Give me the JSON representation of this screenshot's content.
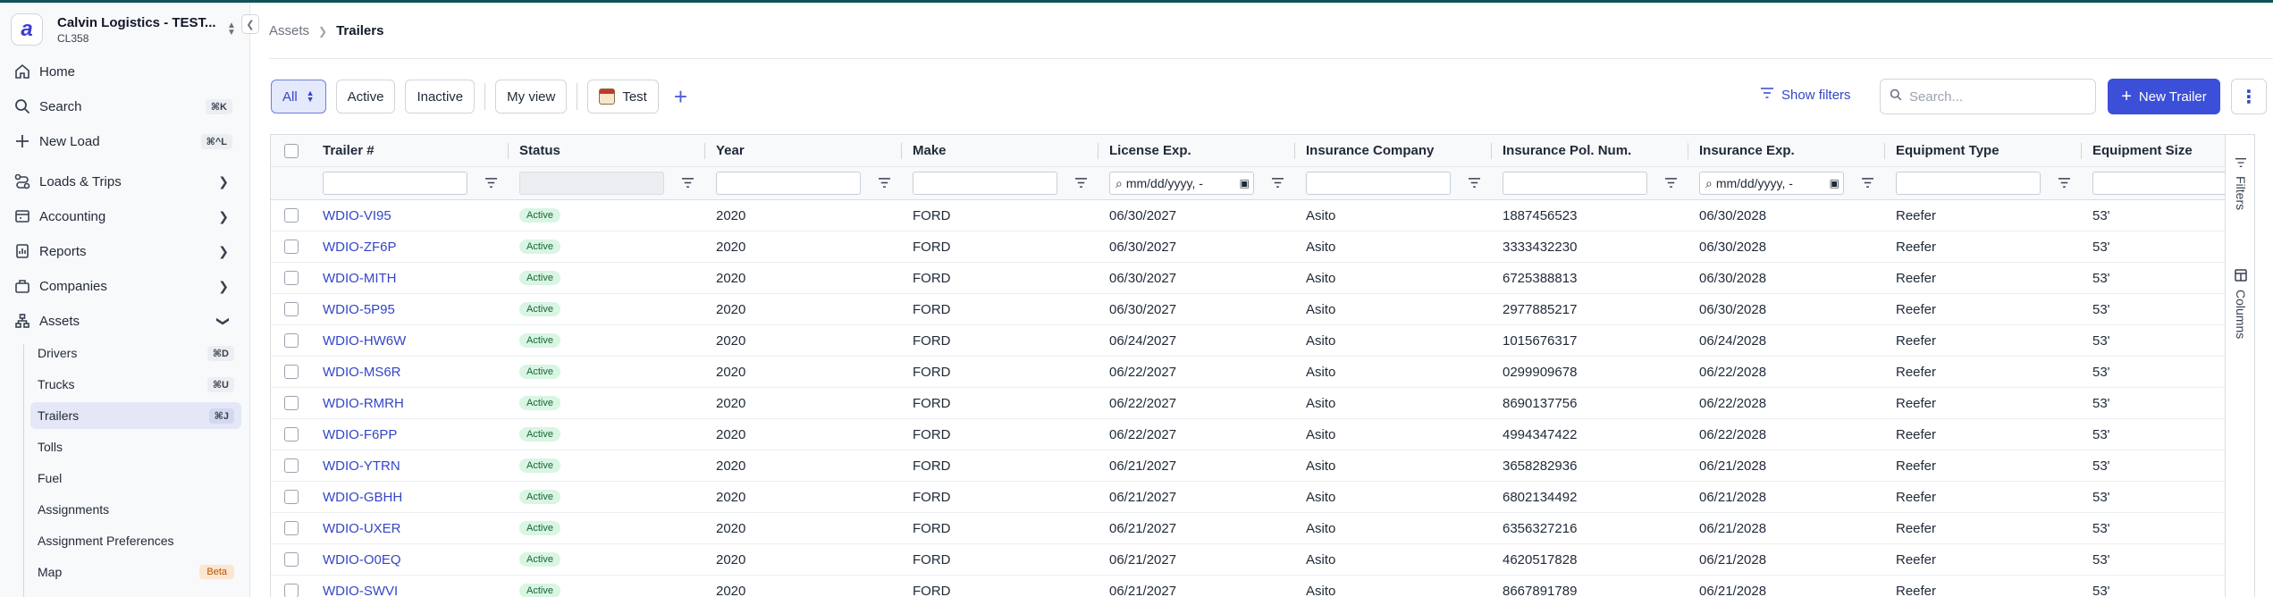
{
  "org": {
    "name": "Calvin Logistics - TEST...",
    "code": "CL358",
    "logo_letter": "a"
  },
  "sidebar": {
    "top_items": [
      {
        "label": "Home",
        "icon": "home-icon"
      },
      {
        "label": "Search",
        "icon": "search-icon",
        "shortcut": "⌘K"
      },
      {
        "label": "New Load",
        "icon": "plus-icon",
        "shortcut": "⌘^L"
      }
    ],
    "sections": [
      {
        "label": "Loads & Trips",
        "icon": "route-icon"
      },
      {
        "label": "Accounting",
        "icon": "accounting-icon"
      },
      {
        "label": "Reports",
        "icon": "reports-icon"
      },
      {
        "label": "Companies",
        "icon": "companies-icon"
      },
      {
        "label": "Assets",
        "icon": "assets-icon",
        "expanded": true
      }
    ],
    "asset_items": [
      {
        "label": "Drivers",
        "shortcut": "⌘D"
      },
      {
        "label": "Trucks",
        "shortcut": "⌘U"
      },
      {
        "label": "Trailers",
        "shortcut": "⌘J",
        "active": true
      },
      {
        "label": "Tolls"
      },
      {
        "label": "Fuel"
      },
      {
        "label": "Assignments"
      },
      {
        "label": "Assignment Preferences"
      },
      {
        "label": "Map",
        "badge": "Beta"
      }
    ]
  },
  "breadcrumb": {
    "parent": "Assets",
    "current": "Trailers"
  },
  "toolbar": {
    "views": [
      "All",
      "Active",
      "Inactive"
    ],
    "my_view": "My view",
    "saved_view": "Test",
    "show_filters": "Show filters",
    "search_placeholder": "Search...",
    "new_button": "New Trailer"
  },
  "table": {
    "columns": [
      "Trailer #",
      "Status",
      "Year",
      "Make",
      "License Exp.",
      "Insurance Company",
      "Insurance Pol. Num.",
      "Insurance Exp.",
      "Equipment Type",
      "Equipment Size"
    ],
    "date_placeholder": "mm/dd/yyyy, -",
    "rows": [
      [
        "WDIO-VI95",
        "Active",
        "2020",
        "FORD",
        "06/30/2027",
        "Asito",
        "1887456523",
        "06/30/2028",
        "Reefer",
        "53'"
      ],
      [
        "WDIO-ZF6P",
        "Active",
        "2020",
        "FORD",
        "06/30/2027",
        "Asito",
        "3333432230",
        "06/30/2028",
        "Reefer",
        "53'"
      ],
      [
        "WDIO-MITH",
        "Active",
        "2020",
        "FORD",
        "06/30/2027",
        "Asito",
        "6725388813",
        "06/30/2028",
        "Reefer",
        "53'"
      ],
      [
        "WDIO-5P95",
        "Active",
        "2020",
        "FORD",
        "06/30/2027",
        "Asito",
        "2977885217",
        "06/30/2028",
        "Reefer",
        "53'"
      ],
      [
        "WDIO-HW6W",
        "Active",
        "2020",
        "FORD",
        "06/24/2027",
        "Asito",
        "1015676317",
        "06/24/2028",
        "Reefer",
        "53'"
      ],
      [
        "WDIO-MS6R",
        "Active",
        "2020",
        "FORD",
        "06/22/2027",
        "Asito",
        "0299909678",
        "06/22/2028",
        "Reefer",
        "53'"
      ],
      [
        "WDIO-RMRH",
        "Active",
        "2020",
        "FORD",
        "06/22/2027",
        "Asito",
        "8690137756",
        "06/22/2028",
        "Reefer",
        "53'"
      ],
      [
        "WDIO-F6PP",
        "Active",
        "2020",
        "FORD",
        "06/22/2027",
        "Asito",
        "4994347422",
        "06/22/2028",
        "Reefer",
        "53'"
      ],
      [
        "WDIO-YTRN",
        "Active",
        "2020",
        "FORD",
        "06/21/2027",
        "Asito",
        "3658282936",
        "06/21/2028",
        "Reefer",
        "53'"
      ],
      [
        "WDIO-GBHH",
        "Active",
        "2020",
        "FORD",
        "06/21/2027",
        "Asito",
        "6802134492",
        "06/21/2028",
        "Reefer",
        "53'"
      ],
      [
        "WDIO-UXER",
        "Active",
        "2020",
        "FORD",
        "06/21/2027",
        "Asito",
        "6356327216",
        "06/21/2028",
        "Reefer",
        "53'"
      ],
      [
        "WDIO-O0EQ",
        "Active",
        "2020",
        "FORD",
        "06/21/2027",
        "Asito",
        "4620517828",
        "06/21/2028",
        "Reefer",
        "53'"
      ],
      [
        "WDIO-SWVI",
        "Active",
        "2020",
        "FORD",
        "06/21/2027",
        "Asito",
        "8667891789",
        "06/21/2028",
        "Reefer",
        "53'"
      ]
    ]
  },
  "side_panel": {
    "filters": "Filters",
    "columns": "Columns"
  },
  "colors": {
    "accent": "#3b4fd8",
    "link": "#3346c7",
    "active_badge_bg": "#d9f5e3",
    "active_badge_text": "#166534",
    "top_bar": "#0f5257"
  }
}
